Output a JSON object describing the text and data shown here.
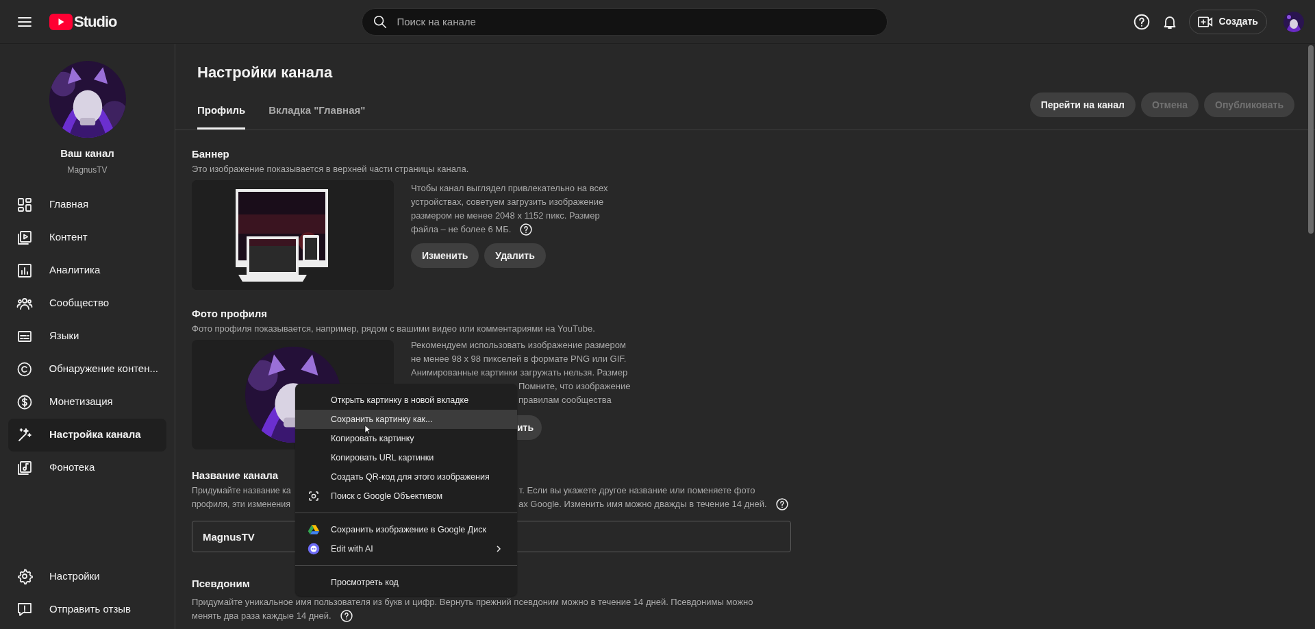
{
  "topbar": {
    "logo_text": "Studio",
    "search": {
      "placeholder": "Поиск на канале"
    },
    "create_label": "Создать"
  },
  "sidebar": {
    "channel_title": "Ваш канал",
    "channel_handle": "MagnusTV",
    "items": [
      {
        "label": "Главная",
        "selected": false
      },
      {
        "label": "Контент",
        "selected": false
      },
      {
        "label": "Аналитика",
        "selected": false
      },
      {
        "label": "Сообщество",
        "selected": false
      },
      {
        "label": "Языки",
        "selected": false
      },
      {
        "label": "Обнаружение контен...",
        "selected": false
      },
      {
        "label": "Монетизация",
        "selected": false
      },
      {
        "label": "Настройка канала",
        "selected": true
      },
      {
        "label": "Фонотека",
        "selected": false
      }
    ],
    "bottom_items": [
      {
        "label": "Настройки"
      },
      {
        "label": "Отправить отзыв"
      }
    ]
  },
  "page": {
    "title": "Настройки канала",
    "tabs": [
      {
        "label": "Профиль",
        "selected": true
      },
      {
        "label": "Вкладка \"Главная\"",
        "selected": false
      }
    ],
    "actions": [
      {
        "label": "Перейти на канал",
        "disabled": false
      },
      {
        "label": "Отмена",
        "disabled": true
      },
      {
        "label": "Опубликовать",
        "disabled": true
      }
    ]
  },
  "banner": {
    "heading": "Баннер",
    "description": "Это изображение показывается в верхней части страницы канала.",
    "info_lines": [
      "Чтобы канал выглядел привлекательно на всех",
      "устройствах, советуем загрузить изображение",
      "размером не менее 2048 x 1152 пикс. Размер",
      "файла – не более 6 МБ."
    ],
    "buttons": [
      "Изменить",
      "Удалить"
    ]
  },
  "profile_photo": {
    "heading": "Фото профиля",
    "description": "Фото профиля показывается, например, рядом с вашими видео или комментариями на YouTube.",
    "info_lines": [
      "Рекомендуем использовать изображение размером",
      "не менее 98 x 98 пикселей в формате PNG или GIF.",
      "Анимированные картинки загружать нельзя. Размер"
    ],
    "info_fragments": [
      "Помните, что изображение",
      "правилам сообщества"
    ],
    "button_fragment": "ить"
  },
  "channel_name": {
    "heading": "Название канала",
    "description_lines": [
      {
        "left": "Придумайте название ка",
        "right": "т. Если вы укажете другое название или поменяете фото"
      },
      {
        "left": "профиля, эти изменения",
        "right": "ах Google. Изменить имя можно дважды в течение 14 дней."
      }
    ],
    "value": "MagnusTV"
  },
  "handle": {
    "heading": "Псевдоним",
    "description_lines": [
      "Придумайте уникальное имя пользователя из букв и цифр. Вернуть прежний псевдоним можно в течение 14 дней. Псевдонимы можно",
      "менять два раза каждые 14 дней."
    ]
  },
  "context_menu": {
    "groups": [
      [
        {
          "label": "Открыть картинку в новой вкладке",
          "highlighted": false,
          "submenu": false
        },
        {
          "label": "Сохранить картинку как...",
          "highlighted": true,
          "submenu": false
        },
        {
          "label": "Копировать картинку",
          "highlighted": false,
          "submenu": false
        },
        {
          "label": "Копировать URL картинки",
          "highlighted": false,
          "submenu": false
        },
        {
          "label": "Создать QR-код для этого изображения",
          "highlighted": false,
          "submenu": false
        },
        {
          "label": "Поиск с Google Объективом",
          "highlighted": false,
          "submenu": false
        }
      ],
      [
        {
          "label": "Сохранить изображение в Google Диск",
          "highlighted": false,
          "submenu": false
        },
        {
          "label": "Edit with AI",
          "highlighted": false,
          "submenu": true
        }
      ],
      [
        {
          "label": "Просмотреть код",
          "highlighted": false,
          "submenu": false
        }
      ]
    ]
  }
}
